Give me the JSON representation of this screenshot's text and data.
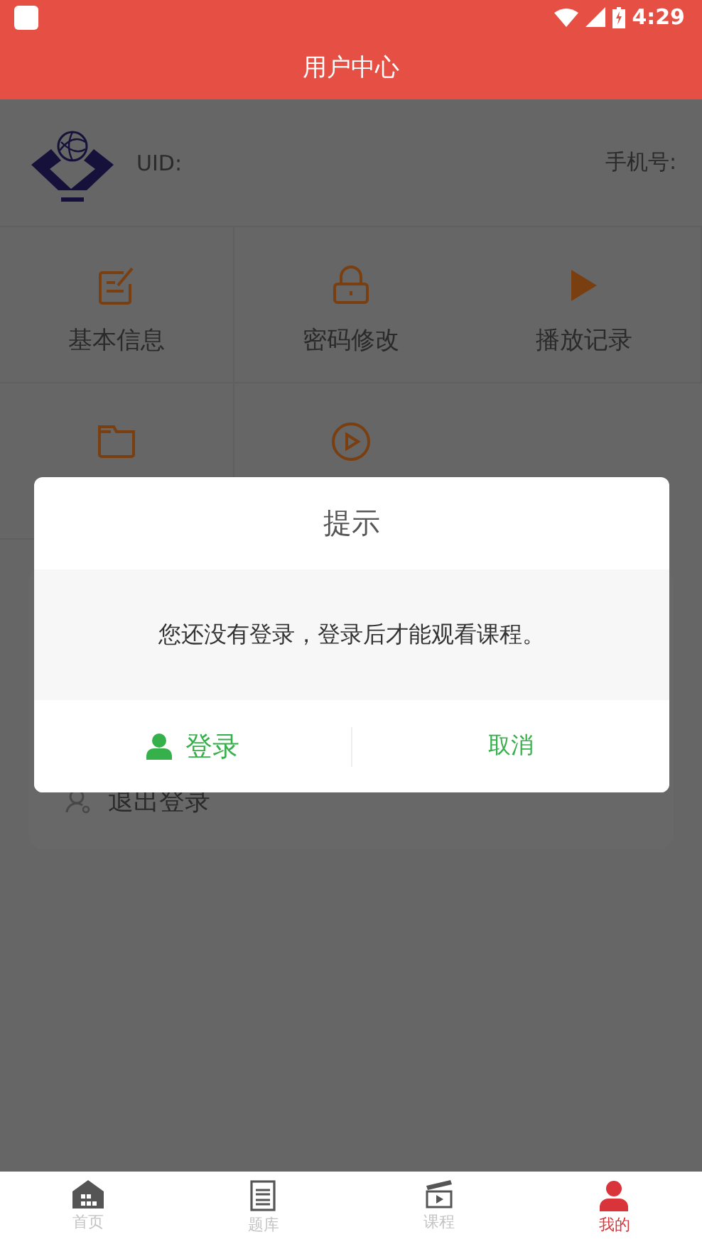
{
  "status_bar": {
    "time": "4:29"
  },
  "app_bar": {
    "title": "用户中心"
  },
  "profile": {
    "uid_label": "UID:",
    "phone_label": "手机号:"
  },
  "menu": [
    {
      "label": "基本信息",
      "kind": "labelled"
    },
    {
      "label": "密码修改",
      "kind": "labelled"
    },
    {
      "label": "播放记录",
      "kind": "labelled"
    },
    {
      "kind": "icon-only"
    },
    {
      "kind": "icon-only"
    }
  ],
  "logout": {
    "label": "退出登录"
  },
  "dialog": {
    "title": "提示",
    "message": "您还没有登录，登录后才能观看课程。",
    "buttons": [
      {
        "label": "登录",
        "kind": "login"
      },
      {
        "label": "取消",
        "kind": "plain"
      }
    ]
  },
  "tab_bar": [
    {
      "label": "首页",
      "selected": false
    },
    {
      "label": "题库",
      "selected": false
    },
    {
      "label": "课程",
      "selected": false
    },
    {
      "label": "我的",
      "selected": true
    }
  ]
}
